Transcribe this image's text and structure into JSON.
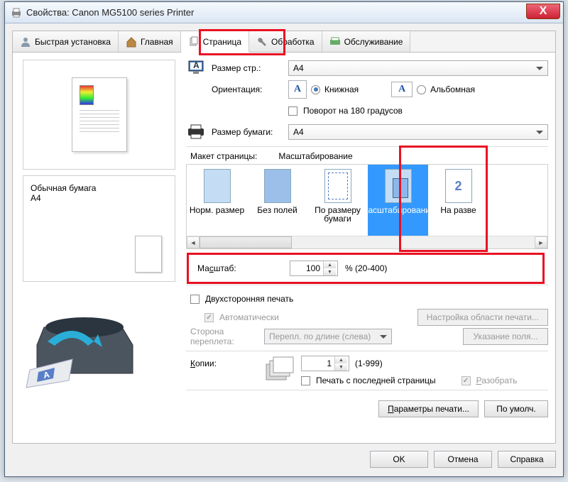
{
  "titlebar": {
    "text": "Свойства: Canon MG5100 series Printer"
  },
  "tabs": {
    "quick": "Быстрая установка",
    "main": "Главная",
    "page": "Страница",
    "process": "Обработка",
    "service": "Обслуживание"
  },
  "left": {
    "info_line1": "Обычная бумага",
    "info_line2": "A4"
  },
  "labels": {
    "page_size": "Размер стр.:",
    "orientation": "Ориентация:",
    "portrait": "Книжная",
    "landscape": "Альбомная",
    "rotate180": "Поворот на 180 градусов",
    "paper_size": "Размер бумаги:",
    "layout": "Макет страницы:",
    "layout_value": "Масштабирование",
    "scale": "Масштаб:",
    "scale_range": "% (20-400)",
    "duplex": "Двухсторонняя печать",
    "auto": "Автоматически",
    "print_area": "Настройка области печати...",
    "binding_side": "Сторона переплета:",
    "binding_value": "Перепл. по длине (слева)",
    "margin": "Указание поля...",
    "copies": "Копии:",
    "copies_range": "(1-999)",
    "from_last": "Печать с последней страницы",
    "collate": "Разобрать",
    "print_params": "Параметры печати...",
    "defaults": "По умолч."
  },
  "values": {
    "page_size": "A4",
    "paper_size": "A4",
    "scale": "100",
    "copies": "1"
  },
  "layout_items": {
    "normal": "Норм. размер",
    "borderless": "Без полей",
    "fit": "По размеру бумаги",
    "scale": "Масштабирование",
    "split": "На разве"
  },
  "footer": {
    "ok": "OK",
    "cancel": "Отмена",
    "help": "Справка"
  }
}
